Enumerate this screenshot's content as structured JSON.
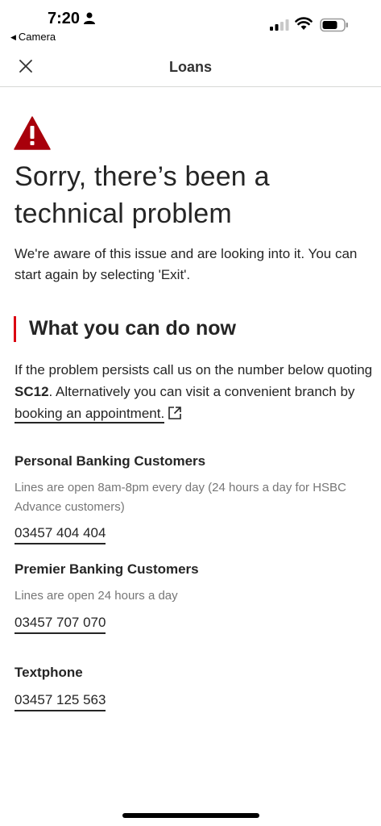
{
  "status_bar": {
    "time": "7:20",
    "back_app": "Camera"
  },
  "header": {
    "title": "Loans"
  },
  "error": {
    "title": "Sorry, there’s been a technical problem",
    "body": "We're aware of this issue and are looking into it. You can start again by selecting 'Exit'."
  },
  "section": {
    "title": "What you can do now",
    "help_prefix": "If the problem persists call us on the number below quoting ",
    "help_code": "SC12",
    "help_middle": ". Alternatively you can visit a convenient branch by ",
    "help_link": "booking an appointment."
  },
  "contacts": {
    "personal": {
      "title": "Personal Banking Customers",
      "note": "Lines are open 8am-8pm every day (24 hours a day for HSBC Advance customers)",
      "phone": "03457 404 404"
    },
    "premier": {
      "title": "Premier Banking Customers",
      "note": "Lines are open 24 hours a day",
      "phone": "03457 707 070"
    },
    "textphone": {
      "title": "Textphone",
      "phone": "03457 125 563"
    }
  },
  "colors": {
    "accent_red": "#db0011",
    "warning_red": "#a8000b",
    "text": "#252525",
    "muted": "#767676"
  },
  "icons": {
    "close": "close-icon",
    "warning": "warning-icon",
    "external": "external-link-icon"
  }
}
